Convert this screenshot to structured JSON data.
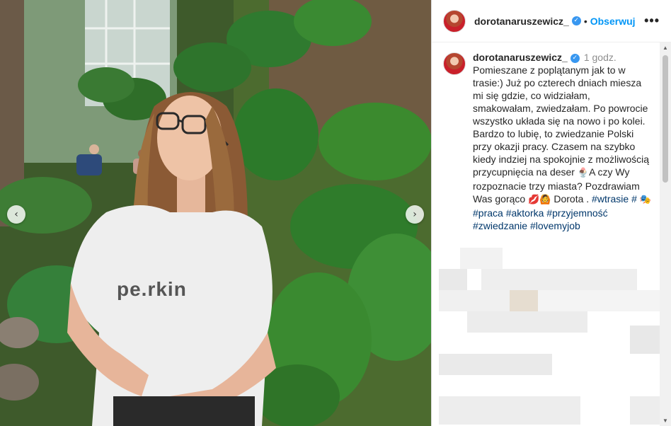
{
  "post": {
    "username": "dorotanaruszewicz_",
    "verified_icon": "verified-badge-icon",
    "dot": "•",
    "follow_label": "Obserwuj",
    "more_label": "•••",
    "time": "1 godz.",
    "caption_text": "Pomieszane z poplątanym jak to w trasie:) Już po czterech dniach miesza mi się gdzie, co widziałam, smakowałam, zwiedzałam. Po powrocie wszystko układa się na nowo i po kolei. Bardzo to lubię, to zwiedzanie Polski przy okazji pracy. Czasem na szybko kiedy indziej na spokojnie z możliwością przycupnięcia na deser",
    "caption_question": "A czy Wy rozpoznacie trzy miasta? Pozdrawiam Was gorąco",
    "caption_sign": "Dorota .",
    "hashtags": [
      "#wtrasie",
      "#praca",
      "#aktorka",
      "#przyjemność",
      "#zwiedzanie",
      "#lovemyjob"
    ]
  },
  "photo": {
    "shirt_text": "pe.rkin",
    "prev_icon": "chevron-left-icon",
    "next_icon": "chevron-right-icon",
    "prev_label": "‹",
    "next_label": "›"
  },
  "colors": {
    "link": "#0095f6",
    "hashtag": "#00376b",
    "muted": "#8e8e8e",
    "text": "#262626"
  }
}
